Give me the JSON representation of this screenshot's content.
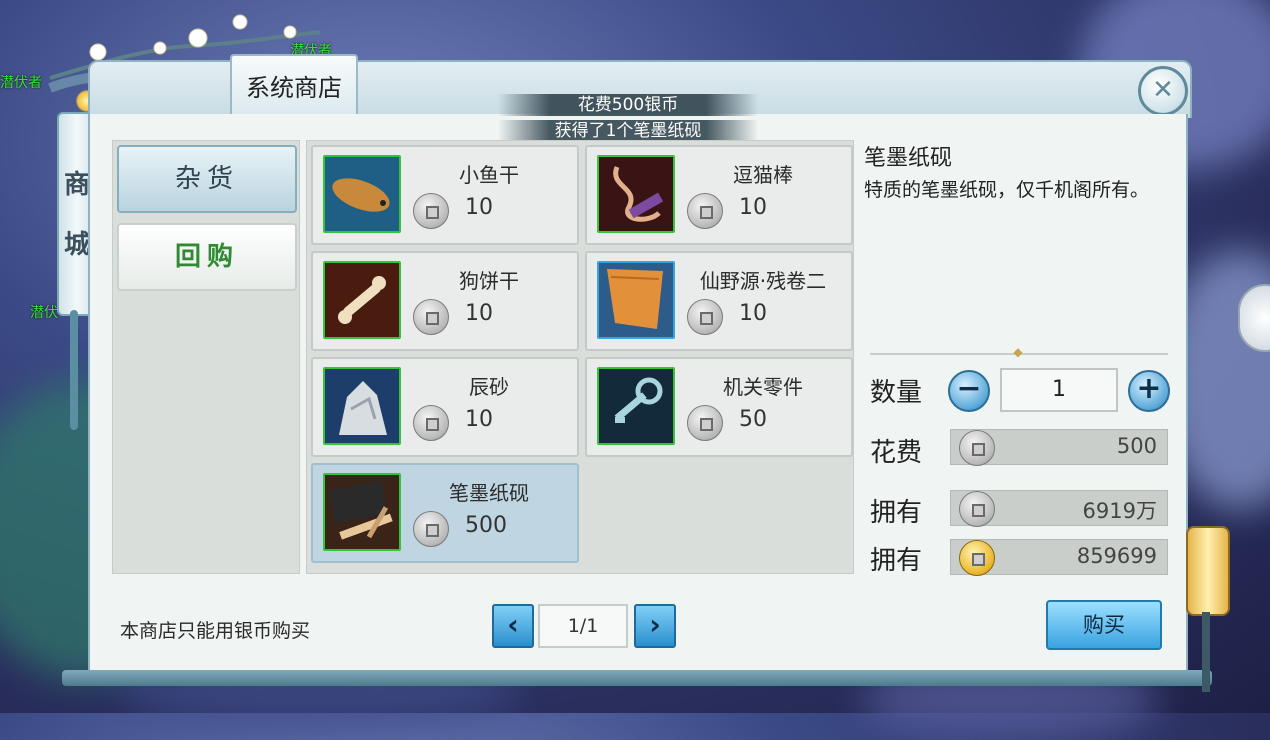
{
  "background_names": [
    "潜伏者",
    "潜伏者",
    "潜伏"
  ],
  "scroll": {
    "chars": [
      "商",
      "城"
    ]
  },
  "shop": {
    "title": "系统商店",
    "notices": [
      "花费500银币",
      "获得了1个笔墨纸砚"
    ]
  },
  "categories": [
    {
      "label": "杂货",
      "active": true
    },
    {
      "label": "回购",
      "active": false
    }
  ],
  "items": [
    {
      "name": "小鱼干",
      "price": "10",
      "icon": "dried-fish-icon",
      "border": "#34c33a"
    },
    {
      "name": "逗猫棒",
      "price": "10",
      "icon": "cat-teaser-icon",
      "border": "#34c33a"
    },
    {
      "name": "狗饼干",
      "price": "10",
      "icon": "dog-biscuit-icon",
      "border": "#34c33a"
    },
    {
      "name": "仙野源·残卷二",
      "price": "10",
      "icon": "scroll-fragment-icon",
      "border": "#37a3e0"
    },
    {
      "name": "辰砂",
      "price": "10",
      "icon": "cinnabar-ore-icon",
      "border": "#34c33a"
    },
    {
      "name": "机关零件",
      "price": "50",
      "icon": "mechanism-key-icon",
      "border": "#34c33a"
    },
    {
      "name": "笔墨纸砚",
      "price": "500",
      "icon": "brush-ink-icon",
      "border": "#34c33a",
      "selected": true
    }
  ],
  "detail": {
    "name": "笔墨纸砚",
    "description": "特质的笔墨纸砚，仅千机阁所有。",
    "quantity_label": "数量",
    "quantity": "1",
    "cost_label": "花费",
    "cost": "500",
    "own_label_silver": "拥有",
    "own_silver": "6919万",
    "own_label_gold": "拥有",
    "own_gold": "859699"
  },
  "footer": {
    "note": "本商店只能用银币购买",
    "page": "1/1",
    "buy_label": "购买"
  },
  "icons": {
    "close": "close-icon",
    "prev": "‹",
    "next": "›",
    "minus": "−",
    "plus": "+"
  },
  "colors": {
    "accent_blue": "#3aa3e0",
    "rarity_green": "#34c33a",
    "rarity_blue": "#37a3e0",
    "category_text_green": "#2f8a32"
  }
}
